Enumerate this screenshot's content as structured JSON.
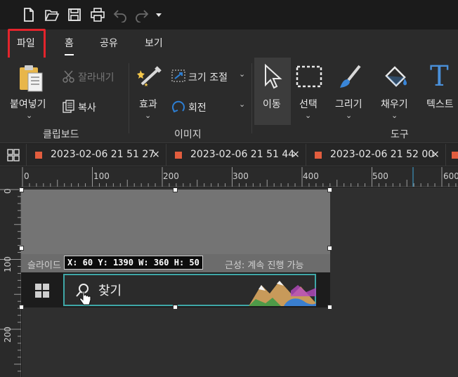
{
  "quick_access": {
    "icons": [
      "new-file-icon",
      "open-folder-icon",
      "save-icon",
      "print-icon",
      "undo-icon",
      "redo-icon",
      "customize-dropdown-icon"
    ]
  },
  "menu_tabs": [
    {
      "label": "파일"
    },
    {
      "label": "홈"
    },
    {
      "label": "공유"
    },
    {
      "label": "보기"
    }
  ],
  "ribbon": {
    "paste": "붙여넣기",
    "cut": "잘라내기",
    "copy": "복사",
    "clipboard_group": "클립보드",
    "effects": "효과",
    "resize": "크기 조절",
    "rotate": "회전",
    "image_group": "이미지",
    "move": "이동",
    "select": "선택",
    "draw": "그리기",
    "fill": "채우기",
    "text": "텍스트",
    "tools_group": "도구",
    "text_icon_glyph": "T"
  },
  "doc_tabs": [
    {
      "title": "2023-02-06 21 51 27"
    },
    {
      "title": "2023-02-06 21 51 44"
    },
    {
      "title": "2023-02-06 21 52 00"
    }
  ],
  "close_glyph": "×",
  "rulers": {
    "h_labels": [
      "0",
      "100",
      "200",
      "300",
      "400",
      "500",
      "600"
    ],
    "v_labels": [
      "0",
      "100",
      "200"
    ]
  },
  "canvas": {
    "strip_left": "슬라이드",
    "strip_right": "근성: 계속 진행 가능",
    "search_text": "찾기",
    "selection_info": "X: 60 Y: 1390 W: 360 H: 50"
  },
  "colors": {
    "highlight_red": "#e4242c",
    "tab_dot": "#e25d3e",
    "search_border": "#3fa7a7",
    "accent_blue": "#2d7fd4"
  }
}
